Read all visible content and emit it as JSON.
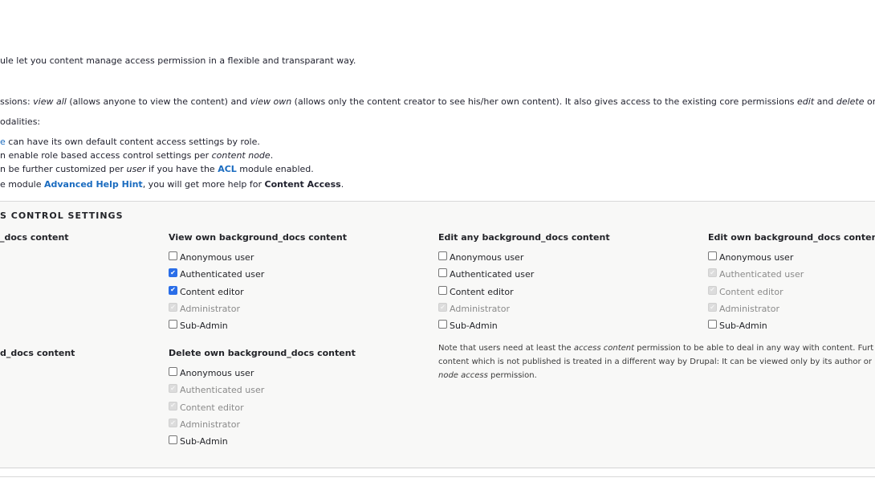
{
  "intro": {
    "line1": "ule let you content manage access permission in a flexible and transparant way.",
    "line2_prefix": "ssions: ",
    "line2_em1": "view all",
    "line2_mid1": " (allows anyone to view the content) and ",
    "line2_em2": "view own",
    "line2_mid2": " (allows only the content creator to see his/her own content). It also gives access to the existing core permissions ",
    "line2_em3": "edit",
    "line2_mid3": " and ",
    "line2_em4": "delete",
    "line2_suffix": " on the sar",
    "line3": "odalities:",
    "bullet1_link": "e",
    "bullet1_rest": " can have its own default content access settings by role.",
    "bullet2_prefix": "n enable role based access control settings per ",
    "bullet2_em": "content node",
    "bullet2_suffix": ".",
    "bullet3_prefix": "n be further customized per ",
    "bullet3_em": "user",
    "bullet3_mid": " if you have the ",
    "bullet3_link": "ACL",
    "bullet3_suffix": " module enabled.",
    "line4_prefix": "e module ",
    "line4_link": "Advanced Help Hint",
    "line4_mid": ", you will get more help for ",
    "line4_bold": "Content Access",
    "line4_suffix": "."
  },
  "panel": {
    "title": "S CONTROL SETTINGS",
    "groups": [
      {
        "title": "_docs content",
        "options": []
      },
      {
        "title": "View own background_docs content",
        "options": [
          {
            "label": "Anonymous user",
            "checked": false,
            "disabled": false
          },
          {
            "label": "Authenticated user",
            "checked": true,
            "disabled": false
          },
          {
            "label": "Content editor",
            "checked": true,
            "disabled": false
          },
          {
            "label": "Administrator",
            "checked": true,
            "disabled": true
          },
          {
            "label": "Sub-Admin",
            "checked": false,
            "disabled": false
          }
        ]
      },
      {
        "title": "Edit any background_docs content",
        "options": [
          {
            "label": "Anonymous user",
            "checked": false,
            "disabled": false
          },
          {
            "label": "Authenticated user",
            "checked": false,
            "disabled": false
          },
          {
            "label": "Content editor",
            "checked": false,
            "disabled": false
          },
          {
            "label": "Administrator",
            "checked": true,
            "disabled": true
          },
          {
            "label": "Sub-Admin",
            "checked": false,
            "disabled": false
          }
        ]
      },
      {
        "title": "Edit own background_docs content",
        "options": [
          {
            "label": "Anonymous user",
            "checked": false,
            "disabled": false
          },
          {
            "label": "Authenticated user",
            "checked": true,
            "disabled": true
          },
          {
            "label": "Content editor",
            "checked": true,
            "disabled": true
          },
          {
            "label": "Administrator",
            "checked": true,
            "disabled": true
          },
          {
            "label": "Sub-Admin",
            "checked": false,
            "disabled": false
          }
        ]
      },
      {
        "title": "d_docs content",
        "options": []
      },
      {
        "title": "Delete own background_docs content",
        "options": [
          {
            "label": "Anonymous user",
            "checked": false,
            "disabled": false
          },
          {
            "label": "Authenticated user",
            "checked": true,
            "disabled": true
          },
          {
            "label": "Content editor",
            "checked": true,
            "disabled": true
          },
          {
            "label": "Administrator",
            "checked": true,
            "disabled": true
          },
          {
            "label": "Sub-Admin",
            "checked": false,
            "disabled": false
          }
        ]
      }
    ],
    "note": {
      "p1": "Note that users need at least the ",
      "em1": "access content",
      "p2": " permission to be able to deal in any way with content. Furt",
      "line2": "content which is not published is treated in a different way by Drupal: It can be viewed only by its author or",
      "em2": "node access",
      "p3": " permission."
    }
  }
}
